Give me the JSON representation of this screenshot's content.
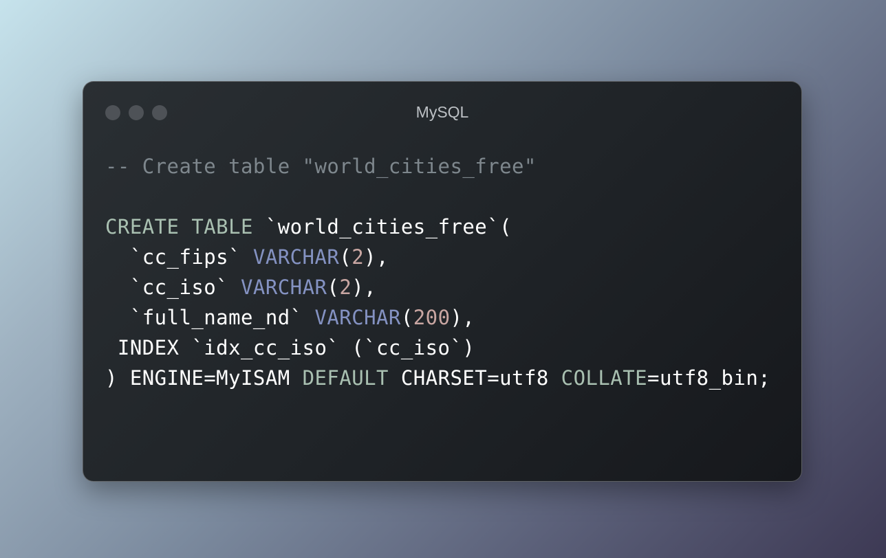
{
  "window": {
    "title": "MySQL"
  },
  "colors": {
    "comment": "#7e878d",
    "keyword": "#a9c0b1",
    "type": "#8492c2",
    "number": "#c9a6a2",
    "plain": "#ffffff",
    "window_bg": "#1f2327"
  },
  "code": {
    "l1": {
      "comment": "-- Create table \"world_cities_free\""
    },
    "l3": {
      "kw": "CREATE TABLE",
      "rest": " `world_cities_free`("
    },
    "l4": {
      "lead": "  `cc_fips` ",
      "type": "VARCHAR",
      "open": "(",
      "num": "2",
      "close": "),"
    },
    "l5": {
      "lead": "  `cc_iso` ",
      "type": "VARCHAR",
      "open": "(",
      "num": "2",
      "close": "),"
    },
    "l6": {
      "lead": "  `full_name_nd` ",
      "type": "VARCHAR",
      "open": "(",
      "num": "200",
      "close": "),"
    },
    "l7": {
      "text": " INDEX `idx_cc_iso` (`cc_iso`)"
    },
    "l8": {
      "part1": ") ENGINE=MyISAM ",
      "kw1": "DEFAULT",
      "part2": " CHARSET=utf8 ",
      "kw2": "COLLATE",
      "part3": "=utf8_bin;"
    }
  }
}
